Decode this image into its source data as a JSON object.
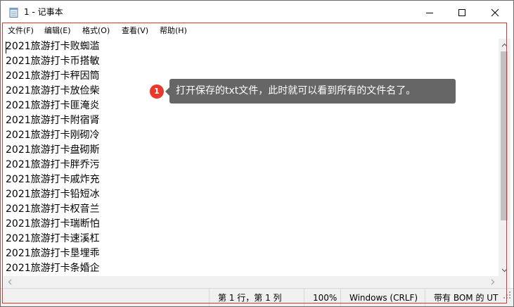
{
  "window": {
    "title": "1 - 记事本"
  },
  "menu": [
    {
      "label": "文件(F)",
      "name": "menu-file"
    },
    {
      "label": "编辑(E)",
      "name": "menu-edit"
    },
    {
      "label": "格式(O)",
      "name": "menu-format"
    },
    {
      "label": "查看(V)",
      "name": "menu-view"
    },
    {
      "label": "帮助(H)",
      "name": "menu-help"
    }
  ],
  "lines": [
    "2021旅游打卡败蜘滥",
    "2021旅游打卡币搭敏",
    "2021旅游打卡秤因筒",
    "2021旅游打卡放俭柴",
    "2021旅游打卡匪淹炎",
    "2021旅游打卡附宿肾",
    "2021旅游打卡刚砌冷",
    "2021旅游打卡盘砌斯",
    "2021旅游打卡胖乔污",
    "2021旅游打卡戚炸充",
    "2021旅游打卡铅短冰",
    "2021旅游打卡权音兰",
    "2021旅游打卡瑞断怕",
    "2021旅游打卡速溪杠",
    "2021旅游打卡垦埋乖",
    "2021旅游打卡条婚企"
  ],
  "status": {
    "position": "第 1 行，第 1 列",
    "zoom": "100%",
    "line_ending": "Windows (CRLF)",
    "encoding": "带有 BOM 的 UT"
  },
  "annotation": {
    "badge": "1",
    "text": "打开保存的txt文件，此时就可以看到所有的文件名了。"
  },
  "colors": {
    "accent_red": "#e8392a",
    "callout_bg": "#666666"
  }
}
